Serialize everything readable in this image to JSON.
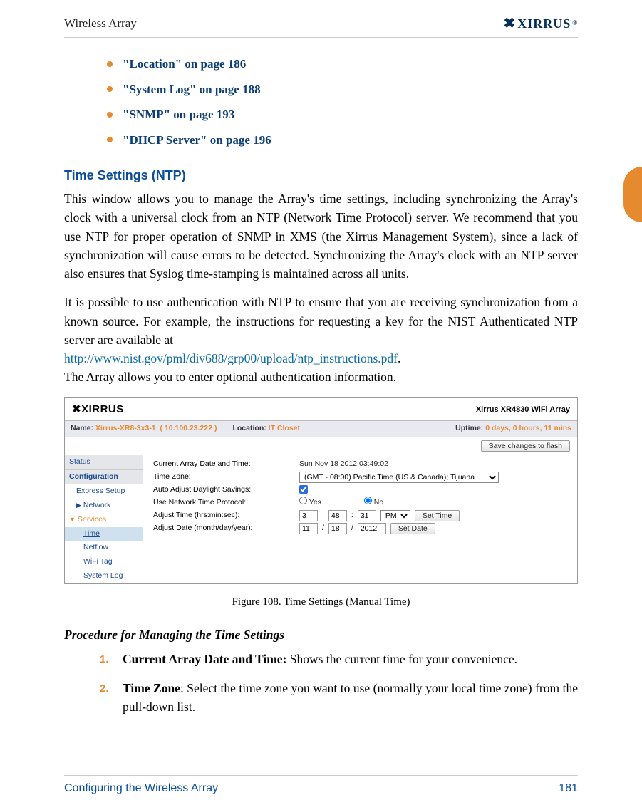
{
  "header": {
    "left": "Wireless Array",
    "logo": "XIRRUS"
  },
  "bullets": [
    "\"Location\" on page 186",
    "\"System Log\" on page 188",
    "\"SNMP\" on page 193",
    "\"DHCP Server\" on page 196"
  ],
  "sectionHeading": "Time Settings (NTP)",
  "para1": "This window allows you to manage the Array's time settings, including synchronizing the Array's clock with a universal clock from an NTP (Network Time Protocol) server. We recommend that you use NTP for proper operation of SNMP in XMS (the Xirrus Management System), since a lack of synchronization will cause errors to be detected. Synchronizing the Array's clock with an NTP server also ensures that Syslog time-stamping is maintained across all units.",
  "para2a": "It is possible to use authentication with NTP to ensure that you are receiving synchronization from a known source. For example, the instructions for requesting a key for the NIST Authenticated NTP server are available at",
  "para2link": "http://www.nist.gov/pml/div688/grp00/upload/ntp_instructions.pdf",
  "para2b": ".",
  "para2c": "The Array allows you to enter optional authentication information.",
  "figure": {
    "logo": "XIRRUS",
    "title": "Xirrus XR4830 WiFi Array",
    "info": {
      "nameLabel": "Name:",
      "nameValue": "Xirrus-XR8-3x3-1",
      "ip": "( 10.100.23.222 )",
      "locLabel": "Location:",
      "locValue": "IT Closet",
      "uptimeLabel": "Uptime:",
      "uptimeValue": "0 days, 0 hours, 11 mins"
    },
    "saveBtn": "Save changes to flash",
    "sidebar": {
      "status": "Status",
      "config": "Configuration",
      "items": [
        "Express Setup",
        "Network",
        "Services"
      ],
      "sub": [
        "Time",
        "Netflow",
        "WiFi Tag",
        "System Log"
      ]
    },
    "rows": {
      "r1l": "Current Array Date and Time:",
      "r1v": "Sun Nov 18 2012 03:49:02",
      "r2l": "Time Zone:",
      "r2v": "(GMT - 08:00) Pacific Time (US & Canada); Tijuana",
      "r3l": "Auto Adjust Daylight Savings:",
      "r4l": "Use Network Time Protocol:",
      "r4yes": "Yes",
      "r4no": "No",
      "r5l": "Adjust Time (hrs:min:sec):",
      "r5h": "3",
      "r5m": "48",
      "r5s": "31",
      "r5ampm": "PM",
      "r5btn": "Set Time",
      "r6l": "Adjust Date (month/day/year):",
      "r6mo": "11",
      "r6d": "18",
      "r6y": "2012",
      "r6btn": "Set Date"
    }
  },
  "figureCaption": "Figure 108. Time Settings (Manual Time)",
  "procHeading": "Procedure for Managing the Time Settings",
  "proc": [
    {
      "num": "1.",
      "bold": "Current Array Date and Time:",
      "rest": " Shows the current time for your convenience."
    },
    {
      "num": "2.",
      "bold": "Time Zone",
      "rest": ": Select the time zone you want to use (normally your local time zone) from the pull-down list."
    }
  ],
  "footer": {
    "left": "Configuring the Wireless Array",
    "right": "181"
  }
}
